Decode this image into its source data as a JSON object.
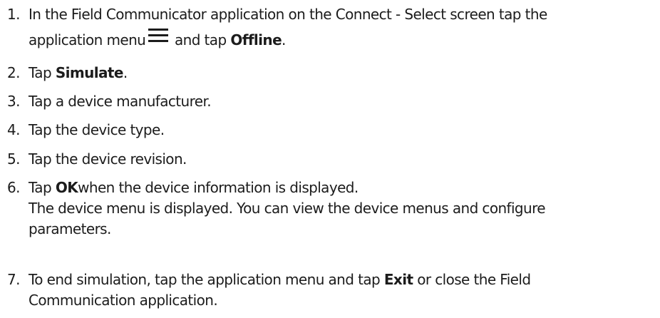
{
  "steps": [
    {
      "number": "1.",
      "line1": "In the Field Communicator application on the Connect - Select screen tap the",
      "line2_before": "application menu",
      "icon": "hamburger-menu-icon",
      "line2_middle": " and tap ",
      "line2_bold": "Offline",
      "line2_after": "."
    },
    {
      "number": "2.",
      "before": "Tap ",
      "bold": "Simulate",
      "after": "."
    },
    {
      "number": "3.",
      "text": "Tap a device manufacturer."
    },
    {
      "number": "4.",
      "text": "Tap the device type."
    },
    {
      "number": "5.",
      "text": "Tap the device revision."
    },
    {
      "number": "6.",
      "before": "Tap ",
      "bold": "OK",
      "after": "when the device information is displayed.",
      "result_line1": "The device menu is displayed. You can view the device menus and configure",
      "result_line2": "parameters."
    },
    {
      "number": "7.",
      "before": "To end simulation, tap the application menu and tap ",
      "bold": "Exit",
      "after": " or close the Field",
      "line2": "Communication application."
    }
  ]
}
